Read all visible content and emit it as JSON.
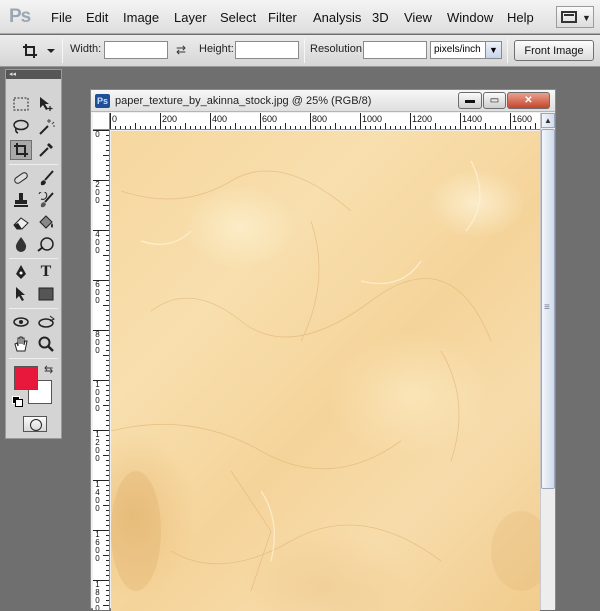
{
  "menubar": {
    "logo": "Ps",
    "items": [
      "File",
      "Edit",
      "Image",
      "Layer",
      "Select",
      "Filter",
      "Analysis",
      "3D",
      "View",
      "Window",
      "Help"
    ],
    "workspace_icon": "fullscreen-mode-icon"
  },
  "options": {
    "width_label": "Width:",
    "width_value": "",
    "swap_icon": "swap-arrows-icon",
    "height_label": "Height:",
    "height_value": "",
    "resolution_label": "Resolution:",
    "resolution_value": "",
    "resolution_unit": "pixels/inch",
    "front_image_label": "Front Image",
    "crop_tool_icon": "crop-icon"
  },
  "tools": {
    "collapse_label": "◂◂",
    "items": [
      "rectangular-marquee-icon",
      "move-icon",
      "lasso-icon",
      "magic-wand-icon",
      "crop-icon",
      "eyedropper-icon",
      "spot-healing-icon",
      "brush-icon",
      "clone-stamp-icon",
      "history-brush-icon",
      "eraser-icon",
      "paint-bucket-icon",
      "blur-icon",
      "dodge-icon",
      "pen-icon",
      "type-icon",
      "path-selection-icon",
      "rectangle-shape-icon",
      "3d-rotate-icon",
      "3d-orbit-icon",
      "hand-icon",
      "zoom-icon"
    ],
    "active_tool": "crop-icon",
    "foreground_color": "#e8173c",
    "background_color": "#ffffff"
  },
  "document": {
    "title": "paper_texture_by_akinna_stock.jpg @ 25% (RGB/8)",
    "minimize_label": "▬",
    "restore_label": "▭",
    "close_label": "✕",
    "ruler_top_labels": [
      "0",
      "200",
      "400",
      "600",
      "800",
      "1000",
      "1200",
      "1400",
      "1600"
    ],
    "ruler_left_labels": [
      "0",
      "200",
      "400",
      "600",
      "800",
      "1000",
      "1200",
      "1400",
      "1600",
      "1800"
    ],
    "canvas_color": "#f6d79f"
  }
}
